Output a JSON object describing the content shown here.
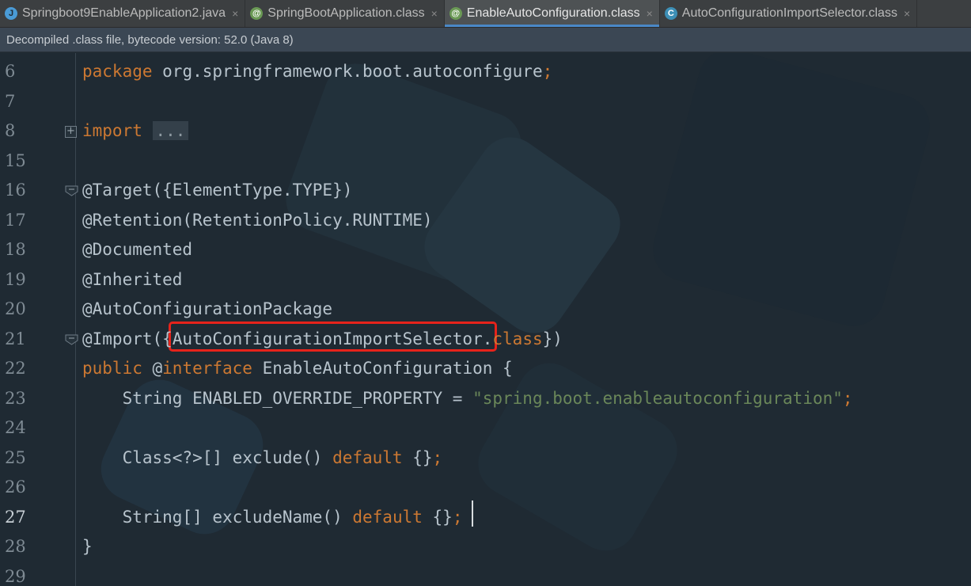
{
  "tabs": [
    {
      "label": "Springboot9EnableApplication2.java",
      "icon": "java-file-icon",
      "glyph": "J",
      "active": false,
      "close": "×"
    },
    {
      "label": "SpringBootApplication.class",
      "icon": "annotation-icon",
      "glyph": "@",
      "active": false,
      "close": "×"
    },
    {
      "label": "EnableAutoConfiguration.class",
      "icon": "annotation-icon",
      "glyph": "@",
      "active": true,
      "close": "×"
    },
    {
      "label": "AutoConfigurationImportSelector.class",
      "icon": "class-icon",
      "glyph": "C",
      "active": false,
      "close": "×"
    }
  ],
  "notice": "Decompiled .class file, bytecode version: 52.0 (Java 8)",
  "editor": {
    "current_line": "27",
    "lines": [
      {
        "num": "6",
        "segments": [
          {
            "t": "package",
            "c": "kw"
          },
          {
            "t": " org.springframework.boot.autoconfigure",
            "c": ""
          },
          {
            "t": ";",
            "c": "kw"
          }
        ]
      },
      {
        "num": "7",
        "segments": []
      },
      {
        "num": "8",
        "fold": "plus",
        "segments": [
          {
            "t": "import",
            "c": "kw"
          },
          {
            "t": " ",
            "c": ""
          },
          {
            "t": "...",
            "c": "collapsed"
          }
        ]
      },
      {
        "num": "15",
        "segments": []
      },
      {
        "num": "16",
        "fold": "minus",
        "segments": [
          {
            "t": "@Target({ElementType.TYPE})",
            "c": ""
          }
        ]
      },
      {
        "num": "17",
        "segments": [
          {
            "t": "@Retention(RetentionPolicy.RUNTIME)",
            "c": ""
          }
        ]
      },
      {
        "num": "18",
        "segments": [
          {
            "t": "@Documented",
            "c": ""
          }
        ]
      },
      {
        "num": "19",
        "segments": [
          {
            "t": "@Inherited",
            "c": ""
          }
        ]
      },
      {
        "num": "20",
        "segments": [
          {
            "t": "@AutoConfigurationPackage",
            "c": ""
          }
        ]
      },
      {
        "num": "21",
        "fold": "minus",
        "segments": [
          {
            "t": "@Import({AutoConfigurationImportSelector",
            "c": ""
          },
          {
            "t": ".",
            "c": ""
          },
          {
            "t": "class",
            "c": "kw"
          },
          {
            "t": "})",
            "c": ""
          }
        ]
      },
      {
        "num": "22",
        "segments": [
          {
            "t": "public",
            "c": "kw"
          },
          {
            "t": " @",
            "c": ""
          },
          {
            "t": "interface",
            "c": "kw"
          },
          {
            "t": " EnableAutoConfiguration {",
            "c": ""
          }
        ]
      },
      {
        "num": "23",
        "segments": [
          {
            "t": "    String ENABLED_OVERRIDE_PROPERTY = ",
            "c": ""
          },
          {
            "t": "\"spring.boot.enableautoconfiguration\"",
            "c": "str"
          },
          {
            "t": ";",
            "c": "kw"
          }
        ]
      },
      {
        "num": "24",
        "segments": []
      },
      {
        "num": "25",
        "segments": [
          {
            "t": "    Class<?>[] exclude() ",
            "c": ""
          },
          {
            "t": "default",
            "c": "kw"
          },
          {
            "t": " {}",
            "c": ""
          },
          {
            "t": ";",
            "c": "kw"
          }
        ]
      },
      {
        "num": "26",
        "segments": []
      },
      {
        "num": "27",
        "segments": [
          {
            "t": "    String[] excludeName() ",
            "c": ""
          },
          {
            "t": "default",
            "c": "kw"
          },
          {
            "t": " {}",
            "c": ""
          },
          {
            "t": ";",
            "c": "kw"
          }
        ]
      },
      {
        "num": "28",
        "segments": [
          {
            "t": "}",
            "c": ""
          }
        ]
      },
      {
        "num": "29",
        "segments": []
      }
    ]
  },
  "colors": {
    "keyword": "#cc7832",
    "string": "#6a8759",
    "highlight_border": "#e6231b",
    "active_tab_underline": "#4a88c7"
  }
}
